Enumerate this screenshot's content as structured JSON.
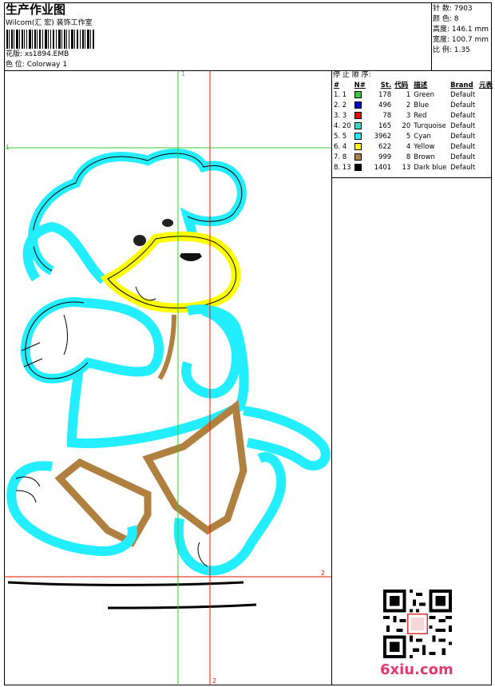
{
  "header": {
    "title": "生产作业图",
    "company": "Wilcom(汇 宏) 装饰工作室",
    "design_label": "花版: ",
    "design_value": "xs1894.EMB",
    "color_label": "色 位: ",
    "color_value": "Colorway 1"
  },
  "meta": {
    "stitches": "针 数: 7903",
    "colors": "颜 色: 8",
    "height": "高度: 146.1 mm",
    "width": "宽度: 100.7 mm",
    "scale": "比 例: 1.35"
  },
  "stop_sequence": {
    "heading": "停 止 顺 序:",
    "columns": [
      "#",
      "N#",
      "St.",
      "代码",
      "描述",
      "Brand",
      "元表"
    ],
    "rows": [
      {
        "idx": "1. 1",
        "color": "#33cc33",
        "st": "178",
        "code": "1",
        "desc": "Green",
        "brand": "Default"
      },
      {
        "idx": "2. 2",
        "color": "#0000dd",
        "st": "496",
        "code": "2",
        "desc": "Blue",
        "brand": "Default"
      },
      {
        "idx": "3. 3",
        "color": "#ee1100",
        "st": "78",
        "code": "3",
        "desc": "Red",
        "brand": "Default"
      },
      {
        "idx": "4. 20",
        "color": "#33e0c8",
        "st": "165",
        "code": "20",
        "desc": "Turquoise",
        "brand": "Default"
      },
      {
        "idx": "5. 5",
        "color": "#22eeff",
        "st": "3962",
        "code": "5",
        "desc": "Cyan",
        "brand": "Default"
      },
      {
        "idx": "6. 4",
        "color": "#ffff00",
        "st": "622",
        "code": "4",
        "desc": "Yellow",
        "brand": "Default"
      },
      {
        "idx": "7. 8",
        "color": "#b08040",
        "st": "999",
        "code": "8",
        "desc": "Brown",
        "brand": "Default"
      },
      {
        "idx": "8. 13",
        "color": "#000000",
        "st": "1401",
        "code": "13",
        "desc": "Dark blue",
        "brand": "Default"
      }
    ]
  },
  "guides": {
    "green_v": "1",
    "green_h": "1",
    "red_v": "2",
    "red_h": "2"
  },
  "watermark": "6xiu.com",
  "colors": {
    "cyan": "#22eeff",
    "yellow": "#ffff00",
    "brown": "#b08040",
    "green_guide": "#33cc33",
    "red_guide": "#ee1100"
  }
}
